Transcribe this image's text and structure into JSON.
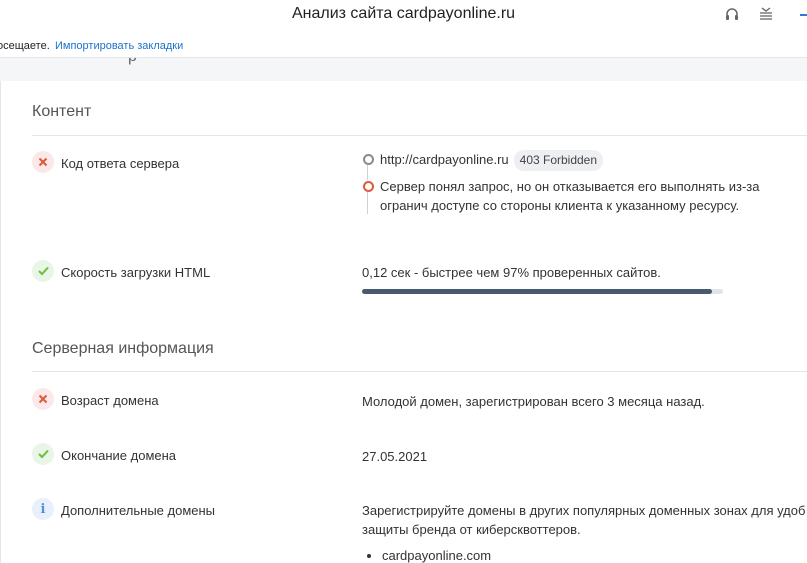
{
  "window": {
    "title": "Анализ сайта cardpayonline.ru"
  },
  "bookmarks_bar": {
    "prefix_text": "осещаете.",
    "import_link": "Импортировать закладки"
  },
  "sections": {
    "content_title": "Контент",
    "server_title": "Серверная информация"
  },
  "rows": {
    "server_code": {
      "label": "Код ответа сервера",
      "url": "http://cardpayonline.ru",
      "badge": "403 Forbidden",
      "message": "Сервер понял запрос, но он отказывается его выполнять из-за огранич доступе со стороны клиента к указанному ресурсу."
    },
    "load_speed": {
      "label": "Скорость загрузки HTML",
      "value": "0,12 сек - быстрее чем 97% проверенных сайтов.",
      "progress_percent": 97
    },
    "domain_age": {
      "label": "Возраст домена",
      "value": "Молодой домен, зарегистрирован всего 3 месяца назад."
    },
    "domain_expiry": {
      "label": "Окончание домена",
      "value": "27.05.2021"
    },
    "extra_domains": {
      "label": "Дополнительные домены",
      "value": "Зарегистрируйте домены в других популярных доменных зонах для удоб защиты бренда от киберсквоттеров.",
      "list": [
        "cardpayonline.com"
      ]
    }
  },
  "colors": {
    "bad": "#e05a3a",
    "good": "#6cbf3a",
    "info": "#5a8fd6",
    "link": "#1a73c8",
    "progress": "#4a5a6e"
  },
  "icons": [
    "headphones-icon",
    "reader-icon",
    "cross-icon",
    "check-icon",
    "info-icon"
  ]
}
